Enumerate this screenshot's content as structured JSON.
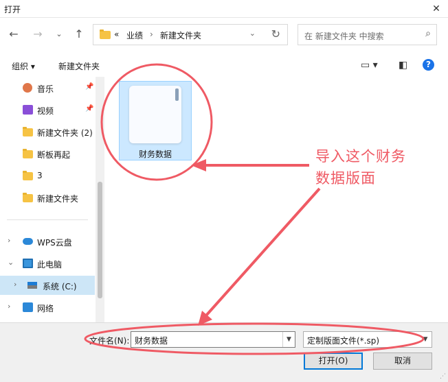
{
  "window": {
    "title": "打开",
    "close": "✕"
  },
  "address": {
    "prefix": "«",
    "crumbs": [
      "业绩",
      "新建文件夹"
    ]
  },
  "search": {
    "placeholder": "在 新建文件夹 中搜索"
  },
  "toolbar": {
    "organize": "组织 ▾",
    "new_folder": "新建文件夹"
  },
  "nav": {
    "quick_items": [
      {
        "label": "音乐",
        "icon": "music-icon"
      },
      {
        "label": "视频",
        "icon": "video-icon"
      },
      {
        "label": "新建文件夹 (2)",
        "icon": "folder-icon"
      },
      {
        "label": "断板再起",
        "icon": "folder-icon"
      },
      {
        "label": "3",
        "icon": "folder-icon"
      },
      {
        "label": "新建文件夹",
        "icon": "folder-icon"
      }
    ],
    "tree_items": [
      {
        "label": "WPS云盘",
        "icon": "cloud-icon",
        "expander": "›"
      },
      {
        "label": "此电脑",
        "icon": "computer-icon",
        "expander": "⌄"
      },
      {
        "label": "系统 (C:)",
        "icon": "drive-icon",
        "expander": "›"
      },
      {
        "label": "网络",
        "icon": "network-icon",
        "expander": "›"
      }
    ]
  },
  "content": {
    "files": [
      {
        "name": "财务数据",
        "icon": "document-icon"
      }
    ]
  },
  "footer": {
    "filename_label": "文件名(N):",
    "filename_value": "财务数据",
    "filetype": "定制版面文件(*.sp)",
    "open_button": "打开(O)",
    "cancel_button": "取消"
  },
  "annotation": {
    "line1": "导入这个财务",
    "line2": "数据版面",
    "color": "#ef5a64"
  },
  "colors": {
    "accent": "#0078d7",
    "selection": "#cce8ff",
    "folder": "#f6c344"
  }
}
